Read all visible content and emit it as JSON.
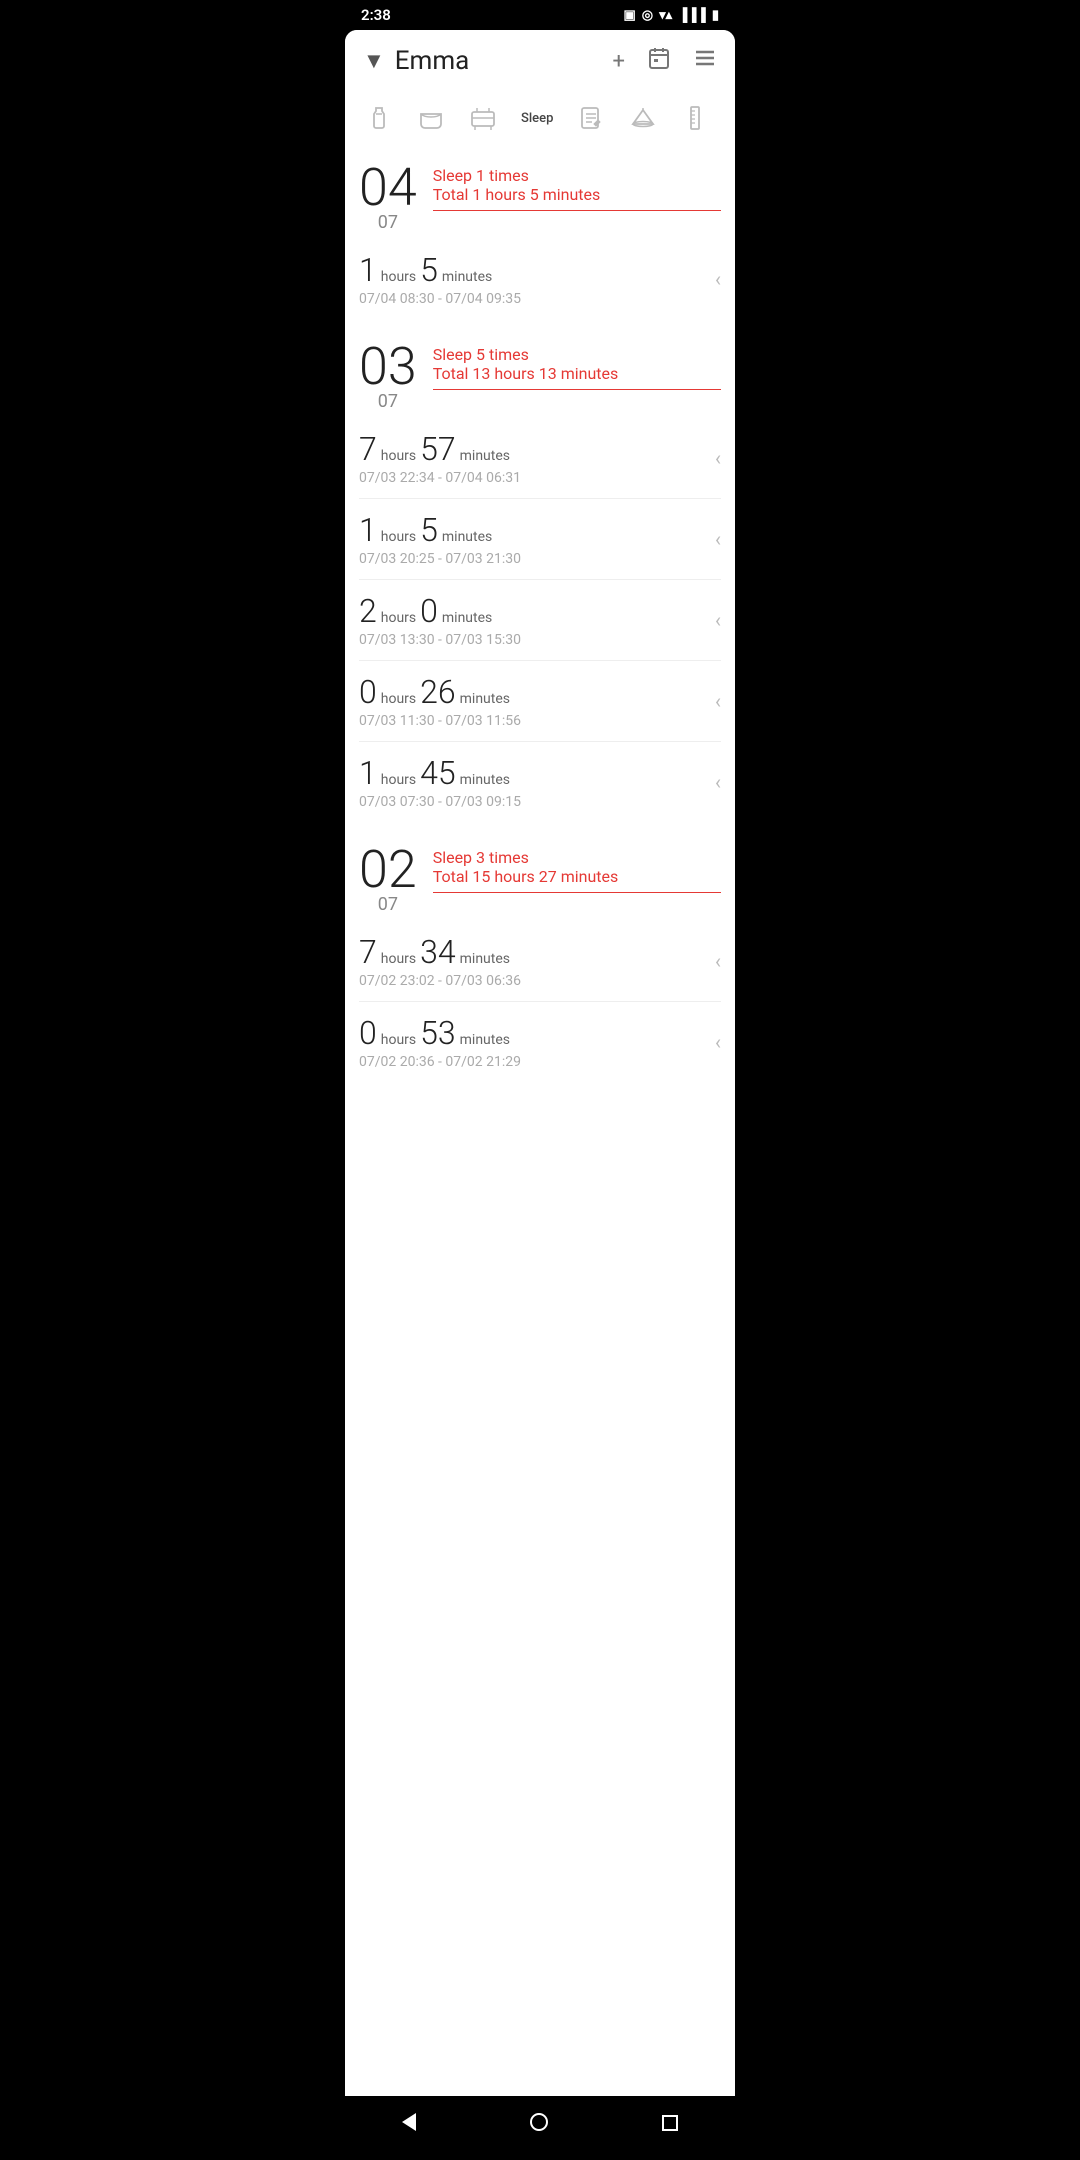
{
  "statusBar": {
    "time": "2:38",
    "icons": [
      "sim-icon",
      "wifi-icon",
      "signal-icon",
      "battery-icon"
    ]
  },
  "header": {
    "dropdown": "▼",
    "title": "Emma",
    "add_label": "+",
    "calendar_label": "📅",
    "menu_label": "☰"
  },
  "categoryNav": {
    "items": [
      {
        "icon": "🍼",
        "label": ""
      },
      {
        "icon": "🩲",
        "label": ""
      },
      {
        "icon": "🛏",
        "label": ""
      },
      {
        "icon": "Sleep",
        "label": "Sleep",
        "active": true
      },
      {
        "icon": "📋",
        "label": ""
      },
      {
        "icon": "⚖️",
        "label": ""
      },
      {
        "icon": "📏",
        "label": ""
      }
    ]
  },
  "days": [
    {
      "day": "04",
      "month": "07",
      "summary_times": "Sleep 1 times",
      "summary_total": "Total 1 hours 5 minutes",
      "entries": [
        {
          "hours_big": "1",
          "hours_label": "hours",
          "mins_big": "5",
          "mins_label": "minutes",
          "time_range": "07/04 08:30 - 07/04 09:35"
        }
      ]
    },
    {
      "day": "03",
      "month": "07",
      "summary_times": "Sleep 5 times",
      "summary_total": "Total 13 hours 13 minutes",
      "entries": [
        {
          "hours_big": "7",
          "hours_label": "hours",
          "mins_big": "57",
          "mins_label": "minutes",
          "time_range": "07/03 22:34 - 07/04 06:31"
        },
        {
          "hours_big": "1",
          "hours_label": "hours",
          "mins_big": "5",
          "mins_label": "minutes",
          "time_range": "07/03 20:25 - 07/03 21:30"
        },
        {
          "hours_big": "2",
          "hours_label": "hours",
          "mins_big": "0",
          "mins_label": "minutes",
          "time_range": "07/03 13:30 - 07/03 15:30"
        },
        {
          "hours_big": "0",
          "hours_label": "hours",
          "mins_big": "26",
          "mins_label": "minutes",
          "time_range": "07/03 11:30 - 07/03 11:56"
        },
        {
          "hours_big": "1",
          "hours_label": "hours",
          "mins_big": "45",
          "mins_label": "minutes",
          "time_range": "07/03 07:30 - 07/03 09:15"
        }
      ]
    },
    {
      "day": "02",
      "month": "07",
      "summary_times": "Sleep 3 times",
      "summary_total": "Total 15 hours 27 minutes",
      "entries": [
        {
          "hours_big": "7",
          "hours_label": "hours",
          "mins_big": "34",
          "mins_label": "minutes",
          "time_range": "07/02 23:02 - 07/03 06:36"
        },
        {
          "hours_big": "0",
          "hours_label": "hours",
          "mins_big": "53",
          "mins_label": "minutes",
          "time_range": "07/02 20:36 - 07/02 21:29"
        }
      ]
    }
  ],
  "bottomNav": {
    "back": "back",
    "home": "home",
    "recent": "recent"
  }
}
